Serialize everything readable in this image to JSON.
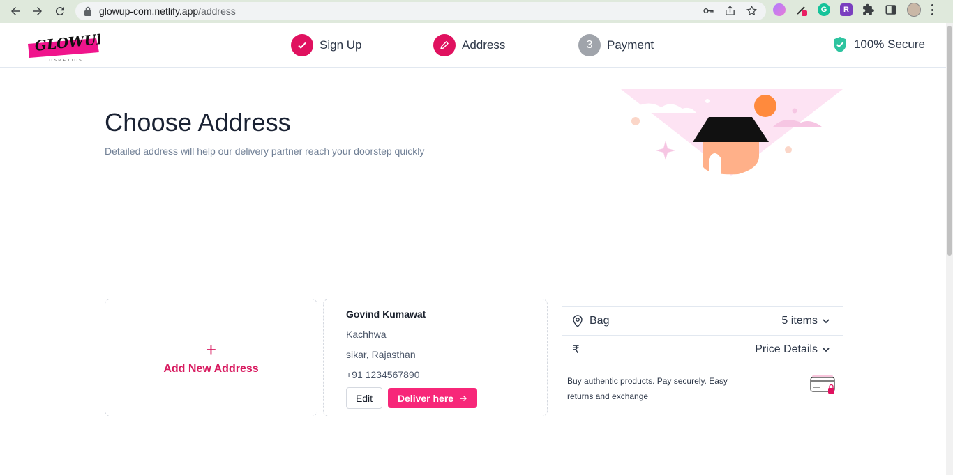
{
  "browser": {
    "url_host": "glowup-com.netlify.app",
    "url_path": "/address"
  },
  "header": {
    "logo_text": "GLOWUP",
    "logo_sub": "COSMETICS",
    "steps": [
      {
        "label": "Sign Up",
        "state": "done"
      },
      {
        "label": "Address",
        "state": "current"
      },
      {
        "label": "Payment",
        "number": "3",
        "state": "pending"
      }
    ],
    "secure_label": "100% Secure"
  },
  "hero": {
    "title": "Choose Address",
    "subtitle": "Detailed address will help our delivery partner reach your doorstep quickly"
  },
  "add_address": {
    "plus": "+",
    "label": "Add New Address"
  },
  "address": {
    "name": "Govind Kumawat",
    "line1": "Kachhwa",
    "line2": "sikar, Rajasthan",
    "phone": "+91 1234567890",
    "edit_label": "Edit",
    "deliver_label": "Deliver here"
  },
  "summary": {
    "bag_label": "Bag",
    "bag_count": "5 items",
    "currency_symbol": "₹",
    "price_label": "Price Details",
    "note": "Buy authentic products. Pay securely. Easy returns and exchange"
  },
  "colors": {
    "brand_pink": "#e0115f",
    "button_pink": "#f72779",
    "secure_green": "#2ec4a0"
  }
}
